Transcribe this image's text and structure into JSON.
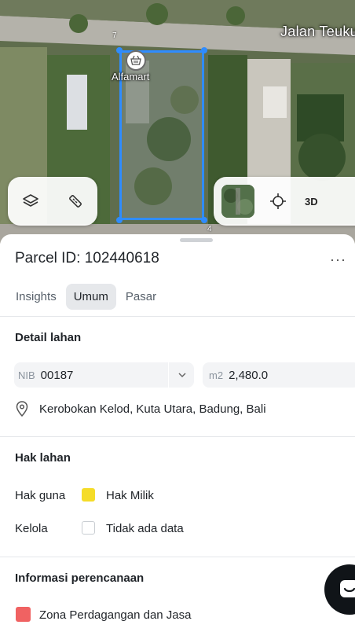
{
  "map": {
    "street_label": "Jalan Teuku",
    "poi_label": "Alfamart",
    "parcel_edge_labels": [
      "7",
      "4"
    ],
    "left_toolbar": [
      {
        "icon": "layers-icon"
      },
      {
        "icon": "ruler-icon"
      }
    ],
    "right_toolbar": {
      "thumbnail": "satellite-thumbnail",
      "locate_icon": "crosshair-icon",
      "three_d_label": "3D"
    },
    "colors": {
      "parcel_outline": "#2f8cff"
    }
  },
  "sheet": {
    "title": "Parcel ID: 102440618",
    "more_label": "···",
    "tabs": [
      {
        "label": "Insights",
        "active": false
      },
      {
        "label": "Umum",
        "active": true
      },
      {
        "label": "Pasar",
        "active": false
      }
    ],
    "detail_lahan": {
      "heading": "Detail lahan",
      "nib_prefix": "NIB",
      "nib_value": "00187",
      "area_prefix": "m2",
      "area_value": "2,480.0",
      "address": "Kerobokan Kelod, Kuta Utara, Badung, Bali"
    },
    "hak_lahan": {
      "heading": "Hak lahan",
      "rows": [
        {
          "label": "Hak guna",
          "value": "Hak Milik",
          "color": "#f5dc28"
        },
        {
          "label": "Kelola",
          "value": "Tidak ada data",
          "color": "#ffffff"
        }
      ]
    },
    "informasi_perencanaan": {
      "heading": "Informasi perencanaan",
      "zone": {
        "label": "Zona Perdagangan dan Jasa",
        "color": "#f06262"
      }
    }
  }
}
